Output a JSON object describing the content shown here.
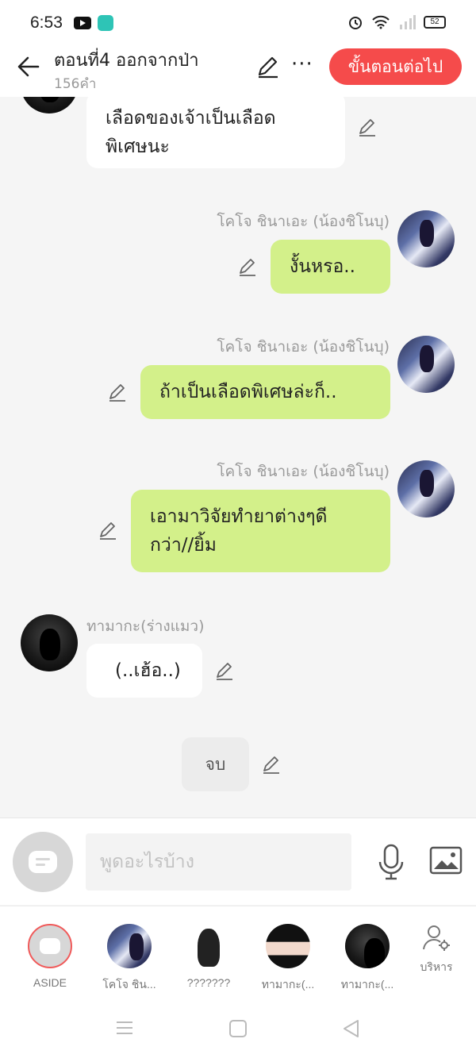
{
  "status_bar": {
    "time": "6:53",
    "battery": "52"
  },
  "header": {
    "title": "ตอนที่4 ออกจากป่า",
    "word_count": "156คำ",
    "more_label": "···",
    "next_button": "ขั้นตอนต่อไป"
  },
  "messages": [
    {
      "speaker": "",
      "side": "left",
      "text_lines": [
        "เลือดของเจ้าเป็นเลือด",
        "พิเศษนะ"
      ]
    },
    {
      "speaker": "โคโจ ชินาเอะ (น้องชิโนบุ)",
      "side": "right",
      "text_lines": [
        "งั้นหรอ.."
      ]
    },
    {
      "speaker": "โคโจ ชินาเอะ (น้องชิโนบุ)",
      "side": "right",
      "text_lines": [
        "ถ้าเป็นเลือดพิเศษล่ะก็.."
      ]
    },
    {
      "speaker": "โคโจ ชินาเอะ (น้องชิโนบุ)",
      "side": "right",
      "text_lines": [
        "เอามาวิจัยทำยาต่างๆดี",
        "กว่า//ยิ้ม"
      ]
    },
    {
      "speaker": "ทามากะ(ร่างแมว)",
      "side": "left",
      "text_lines": [
        "(..เฮ้อ..)"
      ]
    }
  ],
  "end_marker": "จบ",
  "composer": {
    "placeholder": "พูดอะไรบ้าง"
  },
  "characters": [
    {
      "label": "ASIDE"
    },
    {
      "label": "โคโจ ชิน..."
    },
    {
      "label": "???????"
    },
    {
      "label": "ทามากะ(..."
    },
    {
      "label": "ทามากะ(..."
    }
  ],
  "manage_label": "บริหาร",
  "colors": {
    "accent": "#f54b4b",
    "bubble_green": "#d3f08a",
    "bubble_white": "#ffffff"
  }
}
